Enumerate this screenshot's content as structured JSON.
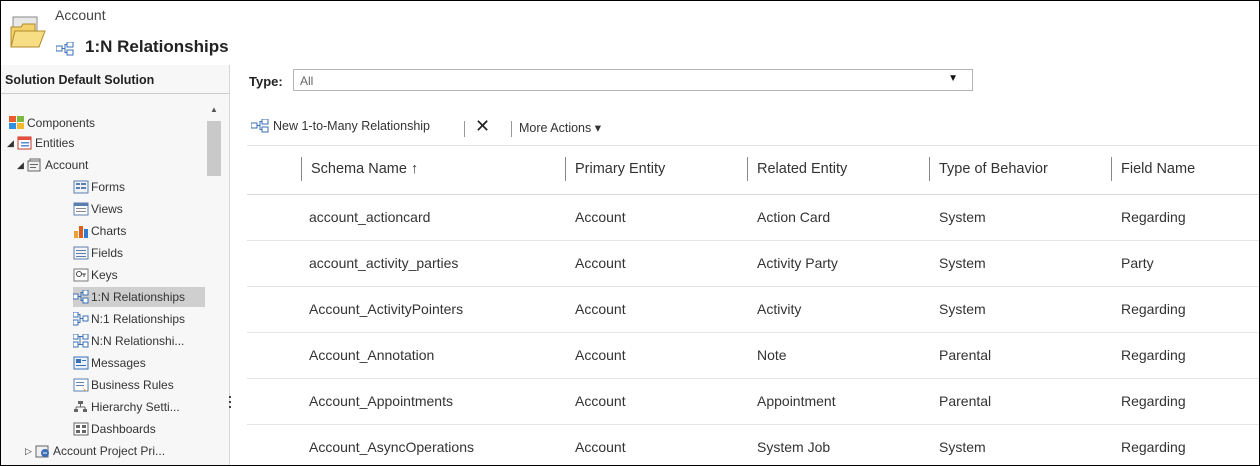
{
  "header": {
    "breadcrumb": "Account",
    "title": "1:N Relationships"
  },
  "leftnav": {
    "solution_label": "Solution Default Solution",
    "items": [
      {
        "label": "Components"
      },
      {
        "label": "Entities"
      },
      {
        "label": "Account"
      },
      {
        "label": "Forms"
      },
      {
        "label": "Views"
      },
      {
        "label": "Charts"
      },
      {
        "label": "Fields"
      },
      {
        "label": "Keys"
      },
      {
        "label": "1:N Relationships"
      },
      {
        "label": "N:1 Relationships"
      },
      {
        "label": "N:N Relationshi..."
      },
      {
        "label": "Messages"
      },
      {
        "label": "Business Rules"
      },
      {
        "label": "Hierarchy Setti..."
      },
      {
        "label": "Dashboards"
      },
      {
        "label": "Account Project Pri..."
      }
    ]
  },
  "filter": {
    "type_label": "Type:",
    "type_value": "All"
  },
  "toolbar": {
    "new_label": "New 1-to-Many Relationship",
    "more_label": "More Actions ▾"
  },
  "grid": {
    "columns": [
      "Schema Name ↑",
      "Primary Entity",
      "Related Entity",
      "Type of Behavior",
      "Field Name"
    ],
    "rows": [
      [
        "account_actioncard",
        "Account",
        "Action Card",
        "System",
        "Regarding"
      ],
      [
        "account_activity_parties",
        "Account",
        "Activity Party",
        "System",
        "Party"
      ],
      [
        "Account_ActivityPointers",
        "Account",
        "Activity",
        "System",
        "Regarding"
      ],
      [
        "Account_Annotation",
        "Account",
        "Note",
        "Parental",
        "Regarding"
      ],
      [
        "Account_Appointments",
        "Account",
        "Appointment",
        "Parental",
        "Regarding"
      ],
      [
        "Account_AsyncOperations",
        "Account",
        "System Job",
        "System",
        "Regarding"
      ]
    ]
  }
}
